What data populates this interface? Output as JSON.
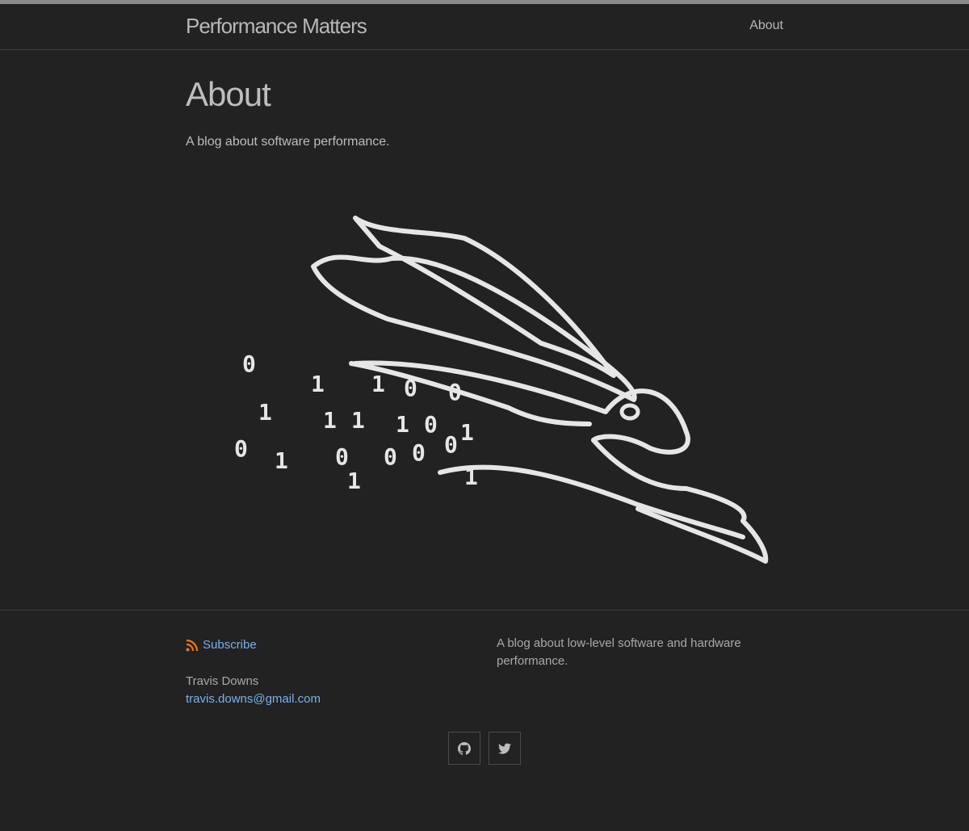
{
  "header": {
    "site_title": "Performance Matters",
    "nav": [
      {
        "label": "About"
      }
    ]
  },
  "main": {
    "title": "About",
    "intro": "A blog about software performance.",
    "illustration": {
      "icon": "rabbit-illustration",
      "digits": [
        "0",
        "1",
        "1",
        "0",
        "0",
        "1",
        "1",
        "1",
        "1",
        "0",
        "1",
        "0",
        "1",
        "0",
        "0",
        "0",
        "0",
        "1",
        "1"
      ]
    }
  },
  "footer": {
    "subscribe_label": "Subscribe",
    "author_name": "Travis Downs",
    "email": "travis.downs@gmail.com",
    "description": "A blog about low-level software and hardware performance.",
    "social": [
      {
        "icon": "github-icon"
      },
      {
        "icon": "twitter-icon"
      }
    ]
  },
  "colors": {
    "background": "#222222",
    "text": "#bdbdbd",
    "link": "#7cb0e8",
    "rss": "#e8791e"
  }
}
